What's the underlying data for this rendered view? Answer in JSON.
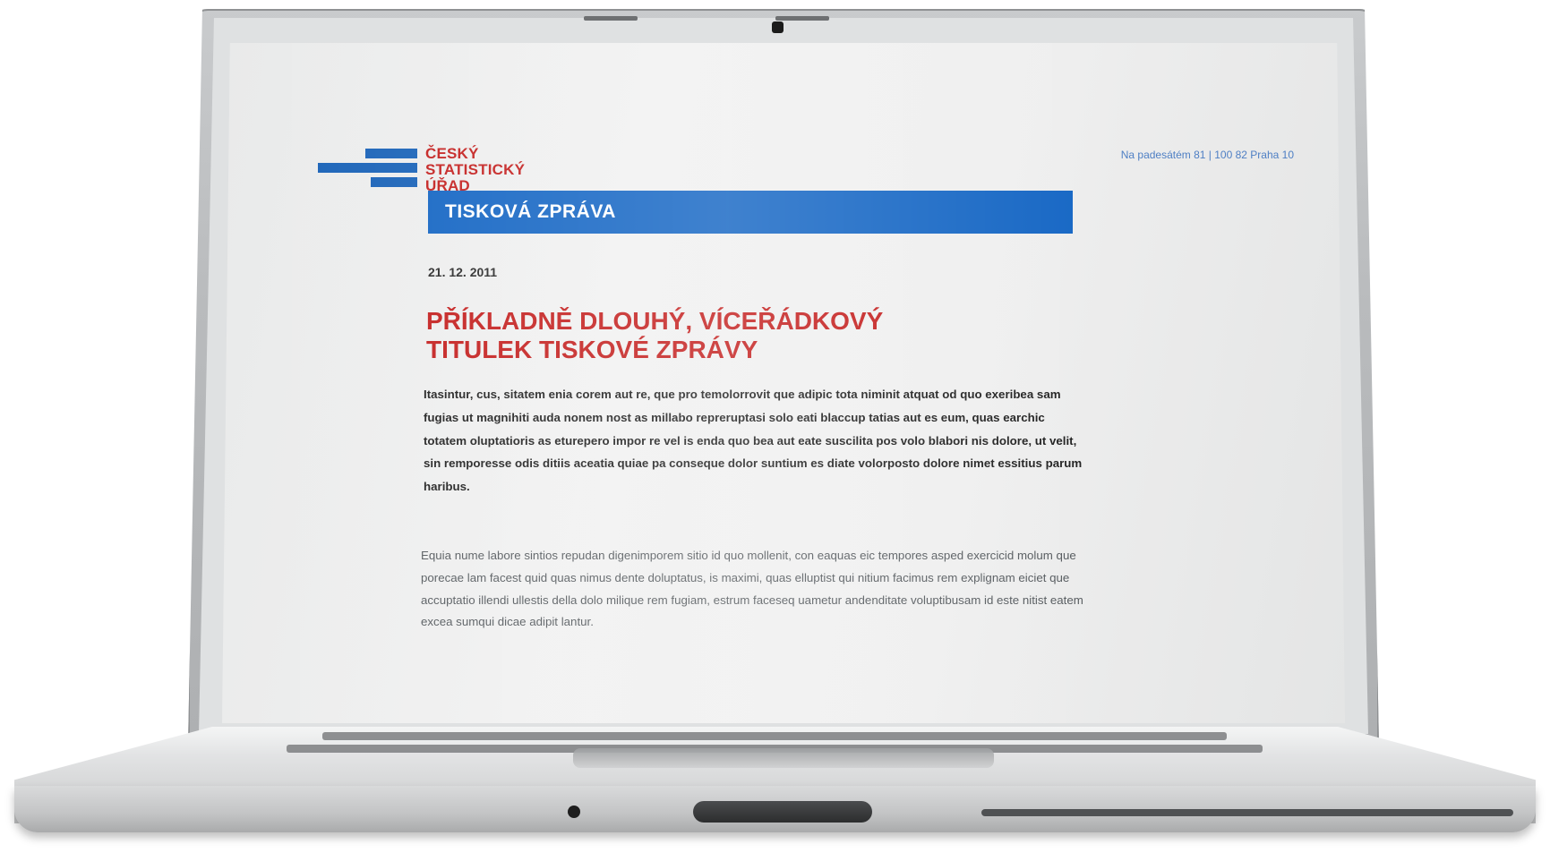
{
  "press_release": {
    "logo": {
      "lines": [
        "ČESKÝ",
        "STATISTICKÝ",
        "ÚŘAD"
      ]
    },
    "address": "Na padesátém 81 | 100 82 Praha 10",
    "banner_title": "TISKOVÁ ZPRÁVA",
    "date": "21. 12. 2011",
    "headline_lines": [
      "PŘÍKLADNĚ DLOUHÝ, VÍCEŘÁDKOVÝ",
      "TITULEK TISKOVÉ ZPRÁVY"
    ],
    "lead_paragraph": "Itasintur, cus, sitatem enia corem aut re, que pro temolorrovit que adipic tota niminit atquat od quo exeribea sam fugias ut magnihiti auda nonem nost as millabo repreruptasi solo eati blaccup tatias aut es eum, quas earchic totatem oluptatioris as eturepero impor re vel is enda quo bea aut eate suscilita pos volo blabori nis dolore, ut velit, sin remporesse odis ditiis aceatia quiae pa conseque dolor suntium es diate volorposto dolore nimet essitius parum haribus.",
    "body_paragraph": "Equia nume labore sintios repudan digenimporem sitio id quo mollenit, con eaquas eic tempores asped exercicid molum que porecae lam facest quid quas nimus dente doluptatus, is maximi, quas elluptist qui nitium facimus rem explignam eiciet que accuptatio illendi ullestis della dolo milique rem fugiam, estrum faceseq uametur andenditate voluptibusam id este nitist eatem excea sumqui dicae adipit lantur."
  },
  "colors": {
    "brand_red": "#c4201f",
    "brand_blue": "#1566c4",
    "address_blue": "#4e7fc4"
  }
}
